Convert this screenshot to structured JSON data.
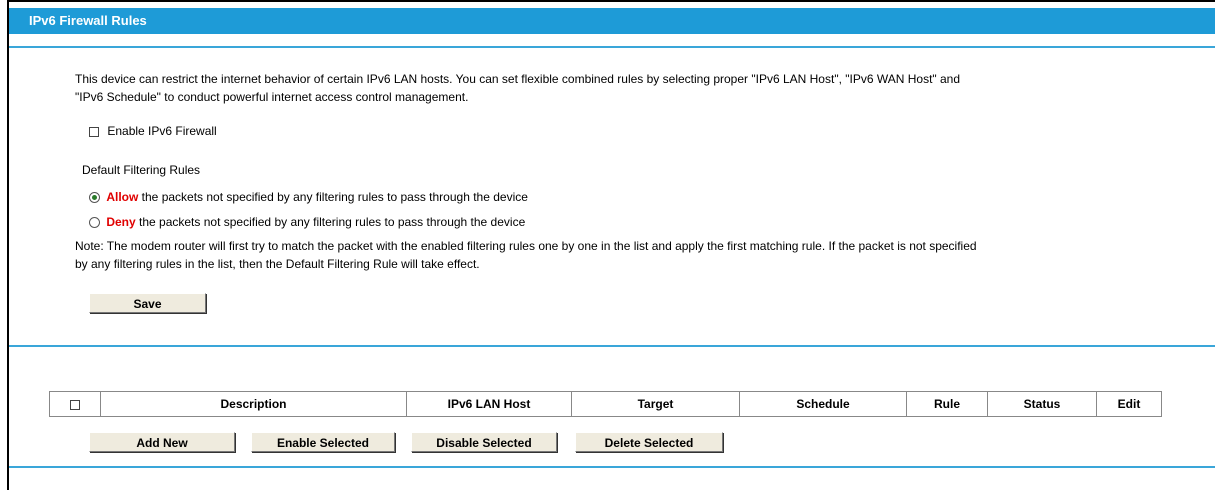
{
  "header": {
    "title": "IPv6 Firewall Rules"
  },
  "intro": {
    "line1": "This device can restrict the internet behavior of certain IPv6 LAN hosts. You can set flexible combined rules by selecting proper \"IPv6 LAN Host\", \"IPv6 WAN Host\" and",
    "line2": "\"IPv6 Schedule\" to conduct powerful internet access control management."
  },
  "enable_firewall": {
    "label": "Enable IPv6 Firewall",
    "checked": false
  },
  "default_rules": {
    "title": "Default Filtering Rules",
    "allow": {
      "keyword": "Allow",
      "text": " the packets not specified by any filtering rules to pass through the device",
      "selected": true
    },
    "deny": {
      "keyword": "Deny",
      "text": " the packets not specified by any filtering rules to pass through the device",
      "selected": false
    }
  },
  "note": {
    "line1": "Note: The modem router will first try to match the packet with the enabled filtering rules one by one in the list and apply the first matching rule. If the packet is not specified",
    "line2": "by any filtering rules in the list, then the Default Filtering Rule will take effect."
  },
  "save_label": "Save",
  "table": {
    "columns": [
      "Description",
      "IPv6 LAN Host",
      "Target",
      "Schedule",
      "Rule",
      "Status",
      "Edit"
    ]
  },
  "buttons": {
    "add_new": "Add New",
    "enable_selected": "Enable Selected",
    "disable_selected": "Disable Selected",
    "delete_selected": "Delete Selected"
  },
  "colors": {
    "header_bg": "#1e9bd7",
    "rule_line": "#3aa6d9",
    "accent_red": "#e00000"
  }
}
